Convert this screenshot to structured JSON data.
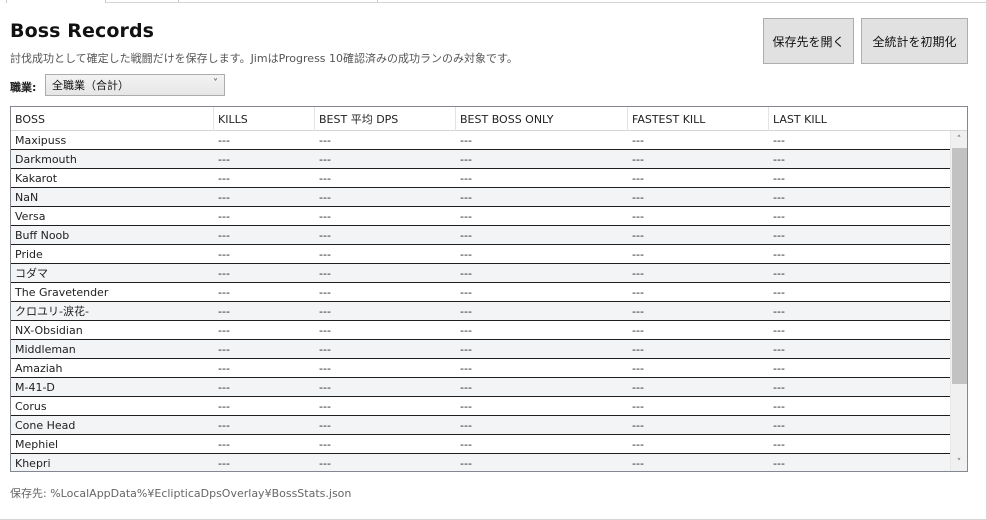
{
  "header": {
    "title": "Boss Records",
    "subtitle": "討伐成功として確定した戦闘だけを保存します。JimはProgress 10確認済みの成功ランのみ対象です。"
  },
  "buttons": {
    "open_save_location": "保存先を開く",
    "reset_all_stats": "全統計を初期化"
  },
  "filter": {
    "label": "職業:",
    "selected": "全職業（合計）"
  },
  "table": {
    "columns": [
      "BOSS",
      "KILLS",
      "BEST 平均 DPS",
      "BEST BOSS ONLY",
      "FASTEST KILL",
      "LAST KILL"
    ],
    "empty_value": "---",
    "rows": [
      "Maxipuss",
      "Darkmouth",
      "Kakarot",
      "NaN",
      "Versa",
      "Buff Noob",
      "Pride",
      "コダマ",
      "The Gravetender",
      "クロユリ-涙花-",
      "NX-Obsidian",
      "Middleman",
      "Amaziah",
      "M-41-D",
      "Corus",
      "Cone Head",
      "Mephiel",
      "Khepri"
    ]
  },
  "footer": {
    "save_path": "保存先: %LocalAppData%¥EclipticaDpsOverlay¥BossStats.json"
  }
}
